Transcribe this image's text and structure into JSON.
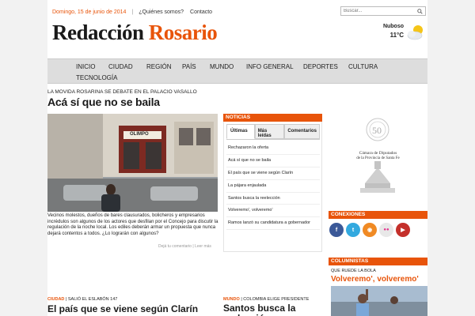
{
  "topbar": {
    "date": "Domingo, 15 de junio de 2014",
    "sep": "|",
    "links": [
      "¿Quiénes somos?",
      "Contacto"
    ],
    "search_placeholder": "Buscar..."
  },
  "logo": {
    "part1": "Redacción",
    "part2": "Rosario"
  },
  "weather": {
    "condition": "Nuboso",
    "temp": "11°C"
  },
  "nav": [
    "INICIO",
    "CIUDAD",
    "REGIÓN",
    "PAÍS",
    "MUNDO",
    "INFO GENERAL",
    "DEPORTES",
    "CULTURA",
    "TECNOLOGÍA"
  ],
  "lead": {
    "kicker": "LA MOVIDA ROSARINA SE DEBATE EN EL PALACIO VASALLO",
    "headline": "Acá sí que no se baila",
    "photo_sign": "OLIMPO",
    "summary": "Vecinos molestos, dueños de bares clausurados, bolicheros y empresarios incrédulos son algunos de los actores que desfilan por el Concejo para discutir la regulación de la noche local. Los ediles deberán armar un propuesta que nunca dejará contentos a todos. ¿Lo lograrán con algunos?",
    "comment_link": "Dejá tu comentario",
    "sep": "|",
    "more_link": "Leer más"
  },
  "news": {
    "heading": "NOTICIAS",
    "tabs": [
      "Últimas",
      "Más leídas",
      "Comentarios"
    ],
    "items": [
      "Rechazaron la oferta",
      "Acá sí que no se baila",
      "El país que se viene según Clarín",
      "La pájara enjaulada",
      "Santos busca la reelección",
      "Volveremo', volveremo'",
      "Ramos lanzó su candidatura a gobernador"
    ]
  },
  "ad": {
    "number": "50",
    "line1": "Cámara de Diputados",
    "line2": "de la Provincia de Santa Fe"
  },
  "connections": {
    "heading": "CONEXIONES",
    "icons": [
      {
        "name": "facebook-icon",
        "glyph": "f",
        "color": "#3b5998"
      },
      {
        "name": "twitter-icon",
        "glyph": "t",
        "color": "#33a9df"
      },
      {
        "name": "rss-icon",
        "glyph": "◉",
        "color": "#f08a24"
      },
      {
        "name": "flickr-icon",
        "glyph": "●●",
        "color": "#e8e8e8"
      },
      {
        "name": "youtube-icon",
        "glyph": "▶",
        "color": "#c4302b"
      }
    ]
  },
  "columnists": {
    "heading": "COLUMNISTAS",
    "kicker": "QUE RUEDE LA BOLA",
    "title": "Volveremo', volveremo'"
  },
  "bottom": [
    {
      "category": "CIUDAD",
      "sep": "|",
      "kicker": "SALIÓ EL ESLABÓN 147",
      "title": "El país que se viene según Clarín"
    },
    {
      "category": "MUNDO",
      "sep": "|",
      "kicker": "COLOMBIA ELIGE PRESIDENTE",
      "title": "Santos busca la reelección"
    }
  ],
  "colors": {
    "accent": "#e8540a",
    "nav_bg": "#dddddd"
  }
}
